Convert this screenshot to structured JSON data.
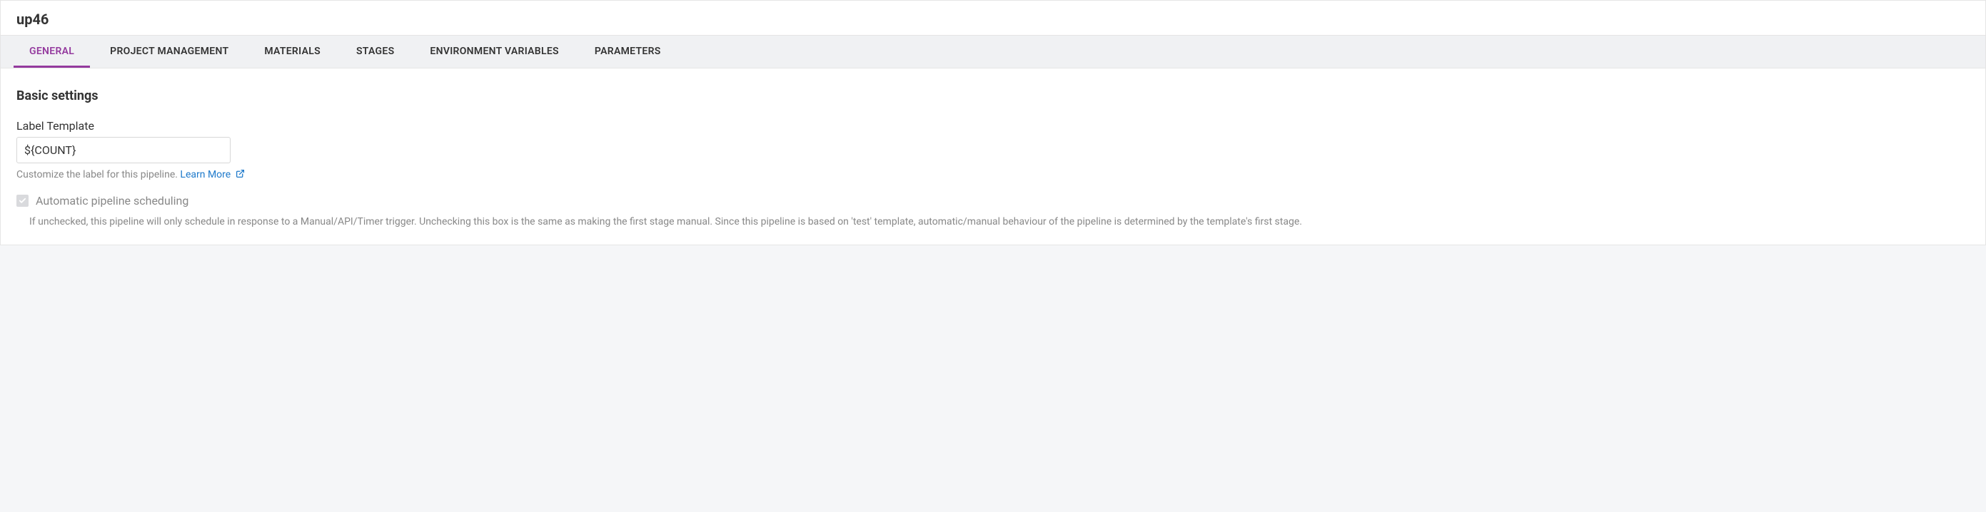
{
  "header": {
    "title": "up46"
  },
  "tabs": [
    {
      "label": "GENERAL",
      "active": true
    },
    {
      "label": "PROJECT MANAGEMENT",
      "active": false
    },
    {
      "label": "MATERIALS",
      "active": false
    },
    {
      "label": "STAGES",
      "active": false
    },
    {
      "label": "ENVIRONMENT VARIABLES",
      "active": false
    },
    {
      "label": "PARAMETERS",
      "active": false
    }
  ],
  "section": {
    "title": "Basic settings"
  },
  "labelTemplate": {
    "label": "Label Template",
    "value": "${COUNT}",
    "help": "Customize the label for this pipeline. ",
    "learnMore": "Learn More"
  },
  "autoSchedule": {
    "label": "Automatic pipeline scheduling",
    "checked": true,
    "disabled": true,
    "description": "If unchecked, this pipeline will only schedule in response to a Manual/API/Timer trigger. Unchecking this box is the same as making the first stage manual. Since this pipeline is based on 'test' template, automatic/manual behaviour of the pipeline is determined by the template's first stage."
  }
}
